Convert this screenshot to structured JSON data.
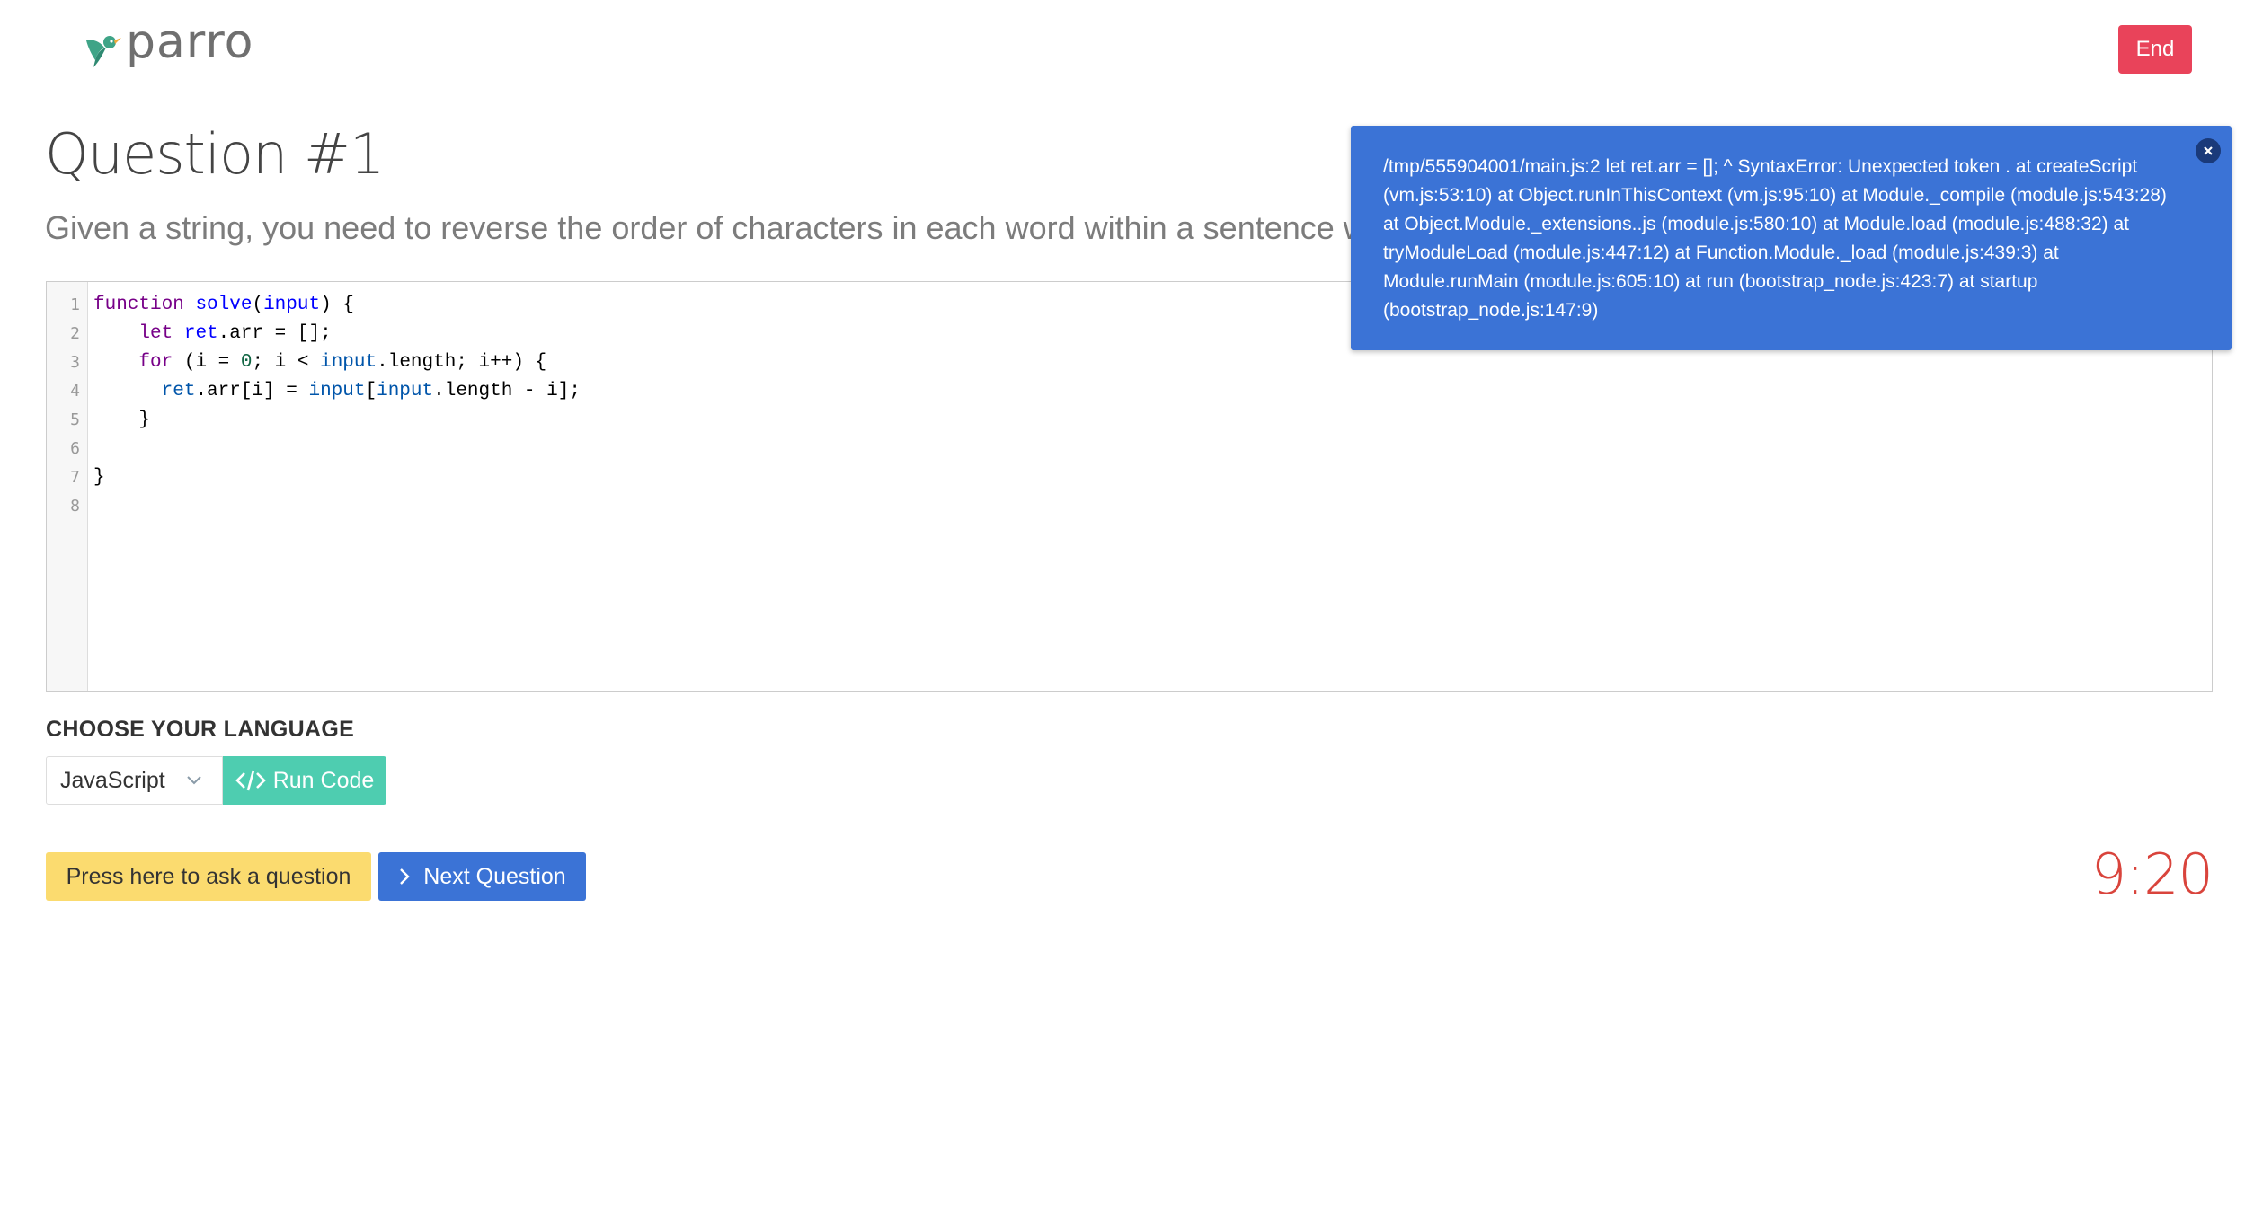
{
  "header": {
    "logo_text": "parro",
    "end_label": "End"
  },
  "question": {
    "title": "Question #1",
    "description": "Given a string, you need to reverse the order of characters in each word within a sentence while s"
  },
  "editor": {
    "line_numbers": [
      "1",
      "2",
      "3",
      "4",
      "5",
      "6",
      "7",
      "8"
    ]
  },
  "language": {
    "label": "CHOOSE YOUR LANGUAGE",
    "selected": "JavaScript",
    "run_label": "Run Code"
  },
  "actions": {
    "ask_label": "Press here to ask a question",
    "next_label": "Next Question"
  },
  "timer": {
    "value": "9:20"
  },
  "toast": {
    "message": "/tmp/555904001/main.js:2 let ret.arr = []; ^ SyntaxError: Unexpected token . at createScript (vm.js:53:10) at Object.runInThisContext (vm.js:95:10) at Module._compile (module.js:543:28) at Object.Module._extensions..js (module.js:580:10) at Module.load (module.js:488:32) at tryModuleLoad (module.js:447:12) at Function.Module._load (module.js:439:3) at Module.runMain (module.js:605:10) at run (bootstrap_node.js:423:7) at startup (bootstrap_node.js:147:9)"
  },
  "icons": {
    "logo": "hummingbird-icon",
    "chevron": "chevron-down-icon",
    "run": "code-brackets-icon",
    "next": "chevron-right-icon",
    "close": "close-icon"
  },
  "colors": {
    "end_button": "#e9435a",
    "run_button": "#4ecdb0",
    "ask_button": "#fbdb6f",
    "next_button": "#3b73d6",
    "toast": "#3b73d6",
    "timer": "#d9443c"
  }
}
